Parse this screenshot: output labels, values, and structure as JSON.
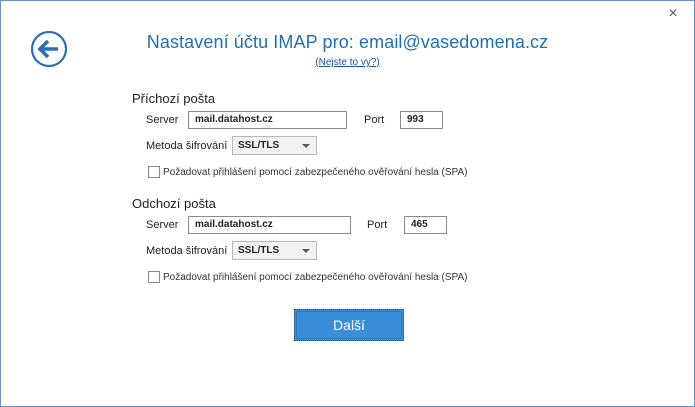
{
  "dialog": {
    "close_glyph": "×",
    "title": "Nastavení účtu IMAP pro: email@vasedomena.cz",
    "not_you_link": "(Nejste to vy?)"
  },
  "incoming": {
    "heading": "Příchozí pošta",
    "server_label": "Server",
    "server_value": "mail.datahost.cz",
    "port_label": "Port",
    "port_value": "993",
    "encryption_label": "Metoda šifrování",
    "encryption_value": "SSL/TLS",
    "spa_label": "Požadovat přihlášení pomocí zabezpečeného ověřování hesla (SPA)",
    "spa_checked": false
  },
  "outgoing": {
    "heading": "Odchozí pošta",
    "server_label": "Server",
    "server_value": "mail.datahost.cz",
    "port_label": "Port",
    "port_value": "465",
    "encryption_label": "Metoda šifrování",
    "encryption_value": "SSL/TLS",
    "spa_label": "Požadovat přihlášení pomocí zabezpečeného ověřování hesla (SPA)",
    "spa_checked": false
  },
  "footer": {
    "next_label": "Další"
  },
  "colors": {
    "title": "#1f6fb5",
    "back_icon": "#2a6db5",
    "button_bg": "#3a8dd8"
  },
  "icons": {
    "back": "back-arrow-icon",
    "close": "close-icon",
    "dropdown": "chevron-down-icon"
  }
}
